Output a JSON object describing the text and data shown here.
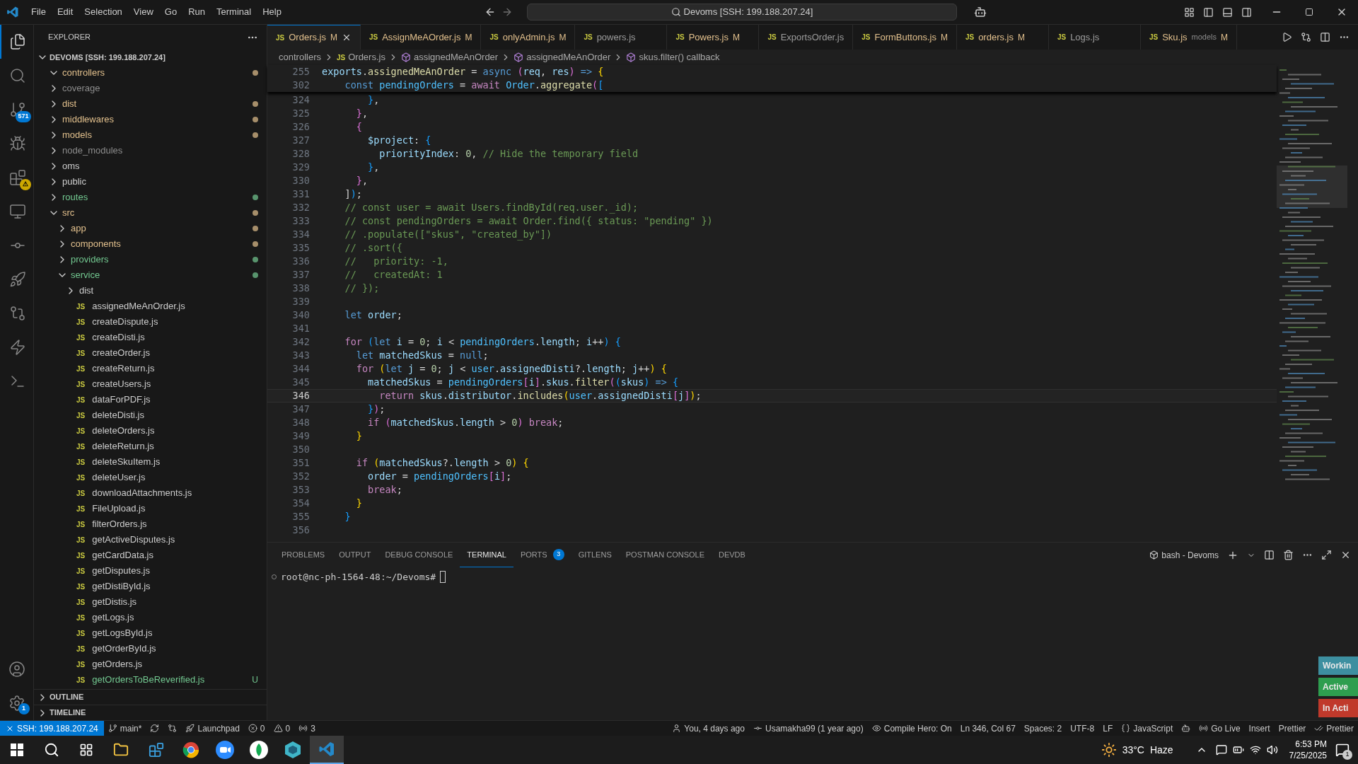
{
  "title_bar": {
    "menu": [
      "File",
      "Edit",
      "Selection",
      "View",
      "Go",
      "Run",
      "Terminal",
      "Help"
    ],
    "search": "Devoms [SSH: 199.188.207.24]"
  },
  "activity_bar": {
    "items": [
      {
        "kind": "files",
        "selected": true
      },
      {
        "kind": "search",
        "selected": false
      },
      {
        "kind": "source-control",
        "selected": false,
        "badge": "571"
      },
      {
        "kind": "debug",
        "selected": false
      },
      {
        "kind": "extensions",
        "selected": false,
        "badge": "⚠"
      },
      {
        "kind": "remote",
        "selected": false
      },
      {
        "kind": "git-graph",
        "selected": false
      },
      {
        "kind": "postman",
        "selected": false
      },
      {
        "kind": "remote-search",
        "selected": false
      },
      {
        "kind": "bolt",
        "selected": false
      },
      {
        "kind": "python",
        "selected": false
      }
    ],
    "bottom": [
      {
        "kind": "account"
      },
      {
        "kind": "settings",
        "badge": "1"
      }
    ]
  },
  "explorer": {
    "title": "EXPLORER",
    "root": "DEVOMS [SSH: 199.188.207.24]",
    "tree": [
      {
        "label": "controllers",
        "kind": "folder",
        "expanded": true,
        "color": "#e2c08d",
        "dot": true
      },
      {
        "label": "coverage",
        "kind": "folder",
        "expanded": false,
        "color": "#8c8c8c",
        "dot": false
      },
      {
        "label": "dist",
        "kind": "folder",
        "expanded": false,
        "color": "#e2c08d",
        "dot": true
      },
      {
        "label": "middlewares",
        "kind": "folder",
        "expanded": false,
        "color": "#e2c08d",
        "dot": true
      },
      {
        "label": "models",
        "kind": "folder",
        "expanded": false,
        "color": "#e2c08d",
        "dot": true
      },
      {
        "label": "node_modules",
        "kind": "folder",
        "expanded": false,
        "color": "#8c8c8c",
        "dot": false
      },
      {
        "label": "oms",
        "kind": "folder",
        "expanded": false,
        "color": "#cccccc",
        "dot": false
      },
      {
        "label": "public",
        "kind": "folder",
        "expanded": false,
        "color": "#cccccc",
        "dot": false
      },
      {
        "label": "routes",
        "kind": "folder",
        "expanded": false,
        "color": "#73c991",
        "dot": true
      },
      {
        "label": "src",
        "kind": "folder",
        "expanded": true,
        "color": "#e2c08d",
        "dot": true,
        "children": [
          {
            "label": "app",
            "kind": "folder",
            "expanded": false,
            "color": "#e2c08d",
            "dot": true
          },
          {
            "label": "components",
            "kind": "folder",
            "expanded": false,
            "color": "#e2c08d",
            "dot": true
          },
          {
            "label": "providers",
            "kind": "folder",
            "expanded": false,
            "color": "#73c991",
            "dot": true
          },
          {
            "label": "service",
            "kind": "folder",
            "expanded": true,
            "color": "#73c991",
            "dot": true,
            "children": [
              {
                "label": "dist",
                "kind": "folder",
                "expanded": false,
                "color": "#cccccc",
                "dot": false
              },
              {
                "label": "assignedMeAnOrder.js",
                "kind": "file",
                "icon_text": "JS",
                "color": "#cccccc",
                "dot": false
              },
              {
                "label": "createDispute.js",
                "kind": "file",
                "icon_text": "JS",
                "color": "#cccccc",
                "dot": false
              },
              {
                "label": "createDisti.js",
                "kind": "file",
                "icon_text": "JS",
                "color": "#cccccc",
                "dot": false
              },
              {
                "label": "createOrder.js",
                "kind": "file",
                "icon_text": "JS",
                "color": "#cccccc",
                "dot": false
              },
              {
                "label": "createReturn.js",
                "kind": "file",
                "icon_text": "JS",
                "color": "#cccccc",
                "dot": false
              },
              {
                "label": "createUsers.js",
                "kind": "file",
                "icon_text": "JS",
                "color": "#cccccc",
                "dot": false
              },
              {
                "label": "dataForPDF.js",
                "kind": "file",
                "icon_text": "JS",
                "color": "#cccccc",
                "dot": false
              },
              {
                "label": "deleteDisti.js",
                "kind": "file",
                "icon_text": "JS",
                "color": "#cccccc",
                "dot": false
              },
              {
                "label": "deleteOrders.js",
                "kind": "file",
                "icon_text": "JS",
                "color": "#cccccc",
                "dot": false
              },
              {
                "label": "deleteReturn.js",
                "kind": "file",
                "icon_text": "JS",
                "color": "#cccccc",
                "dot": false
              },
              {
                "label": "deleteSkuItem.js",
                "kind": "file",
                "icon_text": "JS",
                "color": "#cccccc",
                "dot": false
              },
              {
                "label": "deleteUser.js",
                "kind": "file",
                "icon_text": "JS",
                "color": "#cccccc",
                "dot": false
              },
              {
                "label": "downloadAttachments.js",
                "kind": "file",
                "icon_text": "JS",
                "color": "#cccccc",
                "dot": false
              },
              {
                "label": "FileUpload.js",
                "kind": "file",
                "icon_text": "JS",
                "color": "#cccccc",
                "dot": false
              },
              {
                "label": "filterOrders.js",
                "kind": "file",
                "icon_text": "JS",
                "color": "#cccccc",
                "dot": false
              },
              {
                "label": "getActiveDisputes.js",
                "kind": "file",
                "icon_text": "JS",
                "color": "#cccccc",
                "dot": false
              },
              {
                "label": "getCardData.js",
                "kind": "file",
                "icon_text": "JS",
                "color": "#cccccc",
                "dot": false
              },
              {
                "label": "getDisputes.js",
                "kind": "file",
                "icon_text": "JS",
                "color": "#cccccc",
                "dot": false
              },
              {
                "label": "getDistiById.js",
                "kind": "file",
                "icon_text": "JS",
                "color": "#cccccc",
                "dot": false
              },
              {
                "label": "getDistis.js",
                "kind": "file",
                "icon_text": "JS",
                "color": "#cccccc",
                "dot": false
              },
              {
                "label": "getLogs.js",
                "kind": "file",
                "icon_text": "JS",
                "color": "#cccccc",
                "dot": false
              },
              {
                "label": "getLogsById.js",
                "kind": "file",
                "icon_text": "JS",
                "color": "#cccccc",
                "dot": false
              },
              {
                "label": "getOrderById.js",
                "kind": "file",
                "icon_text": "JS",
                "color": "#cccccc",
                "dot": false
              },
              {
                "label": "getOrders.js",
                "kind": "file",
                "icon_text": "JS",
                "color": "#cccccc",
                "dot": false
              },
              {
                "label": "getOrdersToBeReverified.js",
                "kind": "file",
                "icon_text": "JS",
                "color": "#73c991",
                "dot": false,
                "badge": "U"
              }
            ]
          }
        ]
      }
    ],
    "sections": [
      "OUTLINE",
      "TIMELINE"
    ]
  },
  "tabs": [
    {
      "icon_text": "JS",
      "label": "Orders.js",
      "status": "M",
      "selected": true,
      "color": "#e2c08d"
    },
    {
      "icon_text": "JS",
      "label": "AssignMeAOrder.js",
      "status": "M",
      "selected": false,
      "color": "#e2c08d"
    },
    {
      "icon_text": "JS",
      "label": "onlyAdmin.js",
      "status": "M",
      "selected": false,
      "color": "#e2c08d"
    },
    {
      "icon_text": "JS",
      "label": "powers.js",
      "selected": false,
      "color": "#9d9d9d"
    },
    {
      "icon_text": "JS",
      "label": "Powers.js",
      "status": "M",
      "selected": false,
      "color": "#e2c08d"
    },
    {
      "icon_text": "JS",
      "label": "ExportsOrder.js",
      "selected": false,
      "color": "#9d9d9d"
    },
    {
      "icon_text": "JS",
      "label": "FormButtons.js",
      "status": "M",
      "selected": false,
      "color": "#e2c08d"
    },
    {
      "icon_text": "JS",
      "label": "orders.js",
      "status": "M",
      "selected": false,
      "color": "#e2c08d"
    },
    {
      "icon_text": "JS",
      "label": "Logs.js",
      "selected": false,
      "color": "#9d9d9d"
    },
    {
      "icon_text": "JS",
      "label": "Sku.js",
      "description": "models",
      "status": "M",
      "selected": false,
      "color": "#e2c08d"
    }
  ],
  "breadcrumb": [
    {
      "kind": "folder",
      "label": "controllers"
    },
    {
      "kind": "file",
      "icon_text": "JS",
      "label": "Orders.js"
    },
    {
      "kind": "symbol",
      "label": "assignedMeAnOrder"
    },
    {
      "kind": "symbol",
      "label": "assignedMeAnOrder"
    },
    {
      "kind": "symbol",
      "label": "skus.filter() callback"
    }
  ],
  "sticky": [
    {
      "n": "255",
      "tokens": [
        {
          "text": "exports",
          "kind": "var"
        },
        {
          "text": ".",
          "kind": "plain"
        },
        {
          "text": "assignedMeAnOrder",
          "kind": "fn"
        },
        {
          "text": " = ",
          "kind": "plain"
        },
        {
          "text": "async ",
          "kind": "kw"
        },
        {
          "text": "(",
          "kind": "br2"
        },
        {
          "text": "req",
          "kind": "var"
        },
        {
          "text": ", ",
          "kind": "plain"
        },
        {
          "text": "res",
          "kind": "var"
        },
        {
          "text": ") ",
          "kind": "br2"
        },
        {
          "text": "=> ",
          "kind": "kw"
        },
        {
          "text": "{",
          "kind": "br1"
        }
      ]
    },
    {
      "n": "302",
      "tokens": [
        {
          "text": "    const ",
          "kind": "kw"
        },
        {
          "text": "pendingOrders",
          "kind": "const"
        },
        {
          "text": " = ",
          "kind": "plain"
        },
        {
          "text": "await ",
          "kind": "ctrl"
        },
        {
          "text": "Order",
          "kind": "const"
        },
        {
          "text": ".",
          "kind": "plain"
        },
        {
          "text": "aggregate",
          "kind": "fn"
        },
        {
          "text": "(",
          "kind": "br2"
        },
        {
          "text": "[",
          "kind": "br3"
        }
      ]
    }
  ],
  "code": [
    {
      "n": "324",
      "current": false,
      "tokens": [
        {
          "text": "        }",
          "kind": "br3"
        },
        {
          "text": ",",
          "kind": "plain"
        }
      ]
    },
    {
      "n": "325",
      "current": false,
      "tokens": [
        {
          "text": "      }",
          "kind": "br2"
        },
        {
          "text": ",",
          "kind": "plain"
        }
      ]
    },
    {
      "n": "326",
      "current": false,
      "tokens": [
        {
          "text": "      {",
          "kind": "br2"
        }
      ]
    },
    {
      "n": "327",
      "current": false,
      "tokens": [
        {
          "text": "        $project",
          "kind": "var"
        },
        {
          "text": ": ",
          "kind": "plain"
        },
        {
          "text": "{",
          "kind": "br3"
        }
      ]
    },
    {
      "n": "328",
      "current": false,
      "tokens": [
        {
          "text": "          priorityIndex",
          "kind": "var"
        },
        {
          "text": ": ",
          "kind": "plain"
        },
        {
          "text": "0",
          "kind": "num"
        },
        {
          "text": ", ",
          "kind": "plain"
        },
        {
          "text": "// Hide the temporary field",
          "kind": "cmt"
        }
      ]
    },
    {
      "n": "329",
      "current": false,
      "tokens": [
        {
          "text": "        }",
          "kind": "br3"
        },
        {
          "text": ",",
          "kind": "plain"
        }
      ]
    },
    {
      "n": "330",
      "current": false,
      "tokens": [
        {
          "text": "      }",
          "kind": "br2"
        },
        {
          "text": ",",
          "kind": "plain"
        }
      ]
    },
    {
      "n": "331",
      "current": false,
      "tokens": [
        {
          "text": "    ]",
          "kind": "plain"
        },
        {
          "text": ")",
          "kind": "br3"
        },
        {
          "text": ";",
          "kind": "plain"
        }
      ]
    },
    {
      "n": "332",
      "current": false,
      "tokens": [
        {
          "text": "    // const user = await Users.findById(req.user._id);",
          "kind": "cmt"
        }
      ]
    },
    {
      "n": "333",
      "current": false,
      "tokens": [
        {
          "text": "    // const pendingOrders = await Order.find({ status: \"pending\" })",
          "kind": "cmt"
        }
      ]
    },
    {
      "n": "334",
      "current": false,
      "tokens": [
        {
          "text": "    // .populate([\"skus\", \"created_by\"])",
          "kind": "cmt"
        }
      ]
    },
    {
      "n": "335",
      "current": false,
      "tokens": [
        {
          "text": "    // .sort({",
          "kind": "cmt"
        }
      ]
    },
    {
      "n": "336",
      "current": false,
      "tokens": [
        {
          "text": "    //   priority: -1,",
          "kind": "cmt"
        }
      ]
    },
    {
      "n": "337",
      "current": false,
      "tokens": [
        {
          "text": "    //   createdAt: 1",
          "kind": "cmt"
        }
      ]
    },
    {
      "n": "338",
      "current": false,
      "tokens": [
        {
          "text": "    // });",
          "kind": "cmt"
        }
      ]
    },
    {
      "n": "339",
      "current": false
    },
    {
      "n": "340",
      "current": false,
      "tokens": [
        {
          "text": "    let ",
          "kind": "kw"
        },
        {
          "text": "order",
          "kind": "var"
        },
        {
          "text": ";",
          "kind": "plain"
        }
      ]
    },
    {
      "n": "341",
      "current": false
    },
    {
      "n": "342",
      "current": false,
      "tokens": [
        {
          "text": "    for ",
          "kind": "ctrl"
        },
        {
          "text": "(",
          "kind": "br3"
        },
        {
          "text": "let ",
          "kind": "kw"
        },
        {
          "text": "i",
          "kind": "var"
        },
        {
          "text": " = ",
          "kind": "plain"
        },
        {
          "text": "0",
          "kind": "num"
        },
        {
          "text": "; ",
          "kind": "plain"
        },
        {
          "text": "i",
          "kind": "var"
        },
        {
          "text": " < ",
          "kind": "plain"
        },
        {
          "text": "pendingOrders",
          "kind": "const"
        },
        {
          "text": ".",
          "kind": "plain"
        },
        {
          "text": "length",
          "kind": "var"
        },
        {
          "text": "; ",
          "kind": "plain"
        },
        {
          "text": "i",
          "kind": "var"
        },
        {
          "text": "++",
          "kind": "plain"
        },
        {
          "text": ") {",
          "kind": "br3"
        }
      ]
    },
    {
      "n": "343",
      "current": false,
      "tokens": [
        {
          "text": "      let ",
          "kind": "kw"
        },
        {
          "text": "matchedSkus",
          "kind": "var"
        },
        {
          "text": " = ",
          "kind": "plain"
        },
        {
          "text": "null",
          "kind": "kw"
        },
        {
          "text": ";",
          "kind": "plain"
        }
      ]
    },
    {
      "n": "344",
      "current": false,
      "tokens": [
        {
          "text": "      for ",
          "kind": "ctrl"
        },
        {
          "text": "(",
          "kind": "br1"
        },
        {
          "text": "let ",
          "kind": "kw"
        },
        {
          "text": "j",
          "kind": "var"
        },
        {
          "text": " = ",
          "kind": "plain"
        },
        {
          "text": "0",
          "kind": "num"
        },
        {
          "text": "; ",
          "kind": "plain"
        },
        {
          "text": "j",
          "kind": "var"
        },
        {
          "text": " < ",
          "kind": "plain"
        },
        {
          "text": "user",
          "kind": "const"
        },
        {
          "text": ".",
          "kind": "plain"
        },
        {
          "text": "assignedDisti",
          "kind": "var"
        },
        {
          "text": "?.",
          "kind": "plain"
        },
        {
          "text": "length",
          "kind": "var"
        },
        {
          "text": "; ",
          "kind": "plain"
        },
        {
          "text": "j",
          "kind": "var"
        },
        {
          "text": "++",
          "kind": "plain"
        },
        {
          "text": ") {",
          "kind": "br1"
        }
      ]
    },
    {
      "n": "345",
      "current": false,
      "tokens": [
        {
          "text": "        matchedSkus",
          "kind": "var"
        },
        {
          "text": " = ",
          "kind": "plain"
        },
        {
          "text": "pendingOrders",
          "kind": "const"
        },
        {
          "text": "[",
          "kind": "br2"
        },
        {
          "text": "i",
          "kind": "var"
        },
        {
          "text": "]",
          "kind": "br2"
        },
        {
          "text": ".",
          "kind": "plain"
        },
        {
          "text": "skus",
          "kind": "var"
        },
        {
          "text": ".",
          "kind": "plain"
        },
        {
          "text": "filter",
          "kind": "fn"
        },
        {
          "text": "(",
          "kind": "br2"
        },
        {
          "text": "(",
          "kind": "br3"
        },
        {
          "text": "skus",
          "kind": "var"
        },
        {
          "text": ") ",
          "kind": "br3"
        },
        {
          "text": "=> ",
          "kind": "kw"
        },
        {
          "text": "{",
          "kind": "br3"
        }
      ]
    },
    {
      "n": "346",
      "current": true,
      "tokens": [
        {
          "text": "          return ",
          "kind": "ctrl"
        },
        {
          "text": "skus",
          "kind": "var"
        },
        {
          "text": ".",
          "kind": "plain"
        },
        {
          "text": "distributor",
          "kind": "var"
        },
        {
          "text": ".",
          "kind": "plain"
        },
        {
          "text": "includes",
          "kind": "fn"
        },
        {
          "text": "(",
          "kind": "br1"
        },
        {
          "text": "user",
          "kind": "const"
        },
        {
          "text": ".",
          "kind": "plain"
        },
        {
          "text": "assignedDisti",
          "kind": "var"
        },
        {
          "text": "[",
          "kind": "br2"
        },
        {
          "text": "j",
          "kind": "var"
        },
        {
          "text": "]",
          "kind": "br2"
        },
        {
          "text": ")",
          "kind": "br1"
        },
        {
          "text": ";",
          "kind": "plain"
        }
      ]
    },
    {
      "n": "347",
      "current": false,
      "tokens": [
        {
          "text": "        }",
          "kind": "br3"
        },
        {
          "text": ")",
          "kind": "br2"
        },
        {
          "text": ";",
          "kind": "plain"
        }
      ]
    },
    {
      "n": "348",
      "current": false,
      "tokens": [
        {
          "text": "        if ",
          "kind": "ctrl"
        },
        {
          "text": "(",
          "kind": "br2"
        },
        {
          "text": "matchedSkus",
          "kind": "var"
        },
        {
          "text": ".",
          "kind": "plain"
        },
        {
          "text": "length",
          "kind": "var"
        },
        {
          "text": " > ",
          "kind": "plain"
        },
        {
          "text": "0",
          "kind": "num"
        },
        {
          "text": ") ",
          "kind": "br2"
        },
        {
          "text": "break",
          "kind": "ctrl"
        },
        {
          "text": ";",
          "kind": "plain"
        }
      ]
    },
    {
      "n": "349",
      "current": false,
      "tokens": [
        {
          "text": "      }",
          "kind": "br1"
        }
      ]
    },
    {
      "n": "350",
      "current": false
    },
    {
      "n": "351",
      "current": false,
      "tokens": [
        {
          "text": "      if ",
          "kind": "ctrl"
        },
        {
          "text": "(",
          "kind": "br1"
        },
        {
          "text": "matchedSkus",
          "kind": "var"
        },
        {
          "text": "?.",
          "kind": "plain"
        },
        {
          "text": "length",
          "kind": "var"
        },
        {
          "text": " > ",
          "kind": "plain"
        },
        {
          "text": "0",
          "kind": "num"
        },
        {
          "text": ") {",
          "kind": "br1"
        }
      ]
    },
    {
      "n": "352",
      "current": false,
      "tokens": [
        {
          "text": "        order",
          "kind": "var"
        },
        {
          "text": " = ",
          "kind": "plain"
        },
        {
          "text": "pendingOrders",
          "kind": "const"
        },
        {
          "text": "[",
          "kind": "br2"
        },
        {
          "text": "i",
          "kind": "var"
        },
        {
          "text": "]",
          "kind": "br2"
        },
        {
          "text": ";",
          "kind": "plain"
        }
      ]
    },
    {
      "n": "353",
      "current": false,
      "tokens": [
        {
          "text": "        break",
          "kind": "ctrl"
        },
        {
          "text": ";",
          "kind": "plain"
        }
      ]
    },
    {
      "n": "354",
      "current": false,
      "tokens": [
        {
          "text": "      }",
          "kind": "br1"
        }
      ]
    },
    {
      "n": "355",
      "current": false,
      "tokens": [
        {
          "text": "    }",
          "kind": "br3"
        }
      ]
    },
    {
      "n": "356",
      "current": false
    }
  ],
  "panel": {
    "tabs": [
      {
        "label": "PROBLEMS",
        "selected": false
      },
      {
        "label": "OUTPUT",
        "selected": false
      },
      {
        "label": "DEBUG CONSOLE",
        "selected": false
      },
      {
        "label": "TERMINAL",
        "selected": true
      },
      {
        "label": "PORTS",
        "selected": false,
        "badge": "3"
      },
      {
        "label": "GITLENS",
        "selected": false
      },
      {
        "label": "POSTMAN CONSOLE",
        "selected": false
      },
      {
        "label": "DEVDB",
        "selected": false
      }
    ],
    "shell": "bash - Devoms",
    "prompt": "root@nc-ph-1564-48:~/Devoms#"
  },
  "notifications": [
    {
      "label": "Workin",
      "color": "#3d8fa0"
    },
    {
      "label": "Active",
      "color": "#2e9e4f"
    },
    {
      "label": "In Acti",
      "color": "#c0392b"
    }
  ],
  "status_bar": {
    "remote": "SSH: 199.188.207.24",
    "left": [
      {
        "kind": "branch",
        "label": "main*"
      },
      {
        "kind": "sync"
      },
      {
        "kind": "graph"
      },
      {
        "kind": "launchpad",
        "label": "Launchpad"
      },
      {
        "kind": "errors",
        "label": "0"
      },
      {
        "kind": "warnings",
        "label": "0"
      },
      {
        "kind": "ports",
        "label": "3"
      }
    ],
    "right": [
      {
        "kind": "blame",
        "label": "You, 4 days ago"
      },
      {
        "kind": "author",
        "label": "Usamakha99 (1 year ago)"
      },
      {
        "kind": "eye",
        "label": "Compile Hero: On"
      },
      {
        "kind": "text",
        "label": "Ln 346, Col 67"
      },
      {
        "kind": "text",
        "label": "Spaces: 2"
      },
      {
        "kind": "text",
        "label": "UTF-8"
      },
      {
        "kind": "text",
        "label": "LF"
      },
      {
        "kind": "braces",
        "label": "JavaScript"
      },
      {
        "kind": "copilot"
      },
      {
        "kind": "live",
        "label": "Go Live"
      },
      {
        "kind": "text",
        "label": "Insert"
      },
      {
        "kind": "text",
        "label": "Prettier"
      },
      {
        "kind": "check",
        "label": "Prettier"
      }
    ]
  },
  "taskbar": {
    "weather": "33°C",
    "condition": "Haze",
    "time": "6:53 PM",
    "date": "7/25/2025",
    "notification_badge": "1"
  }
}
